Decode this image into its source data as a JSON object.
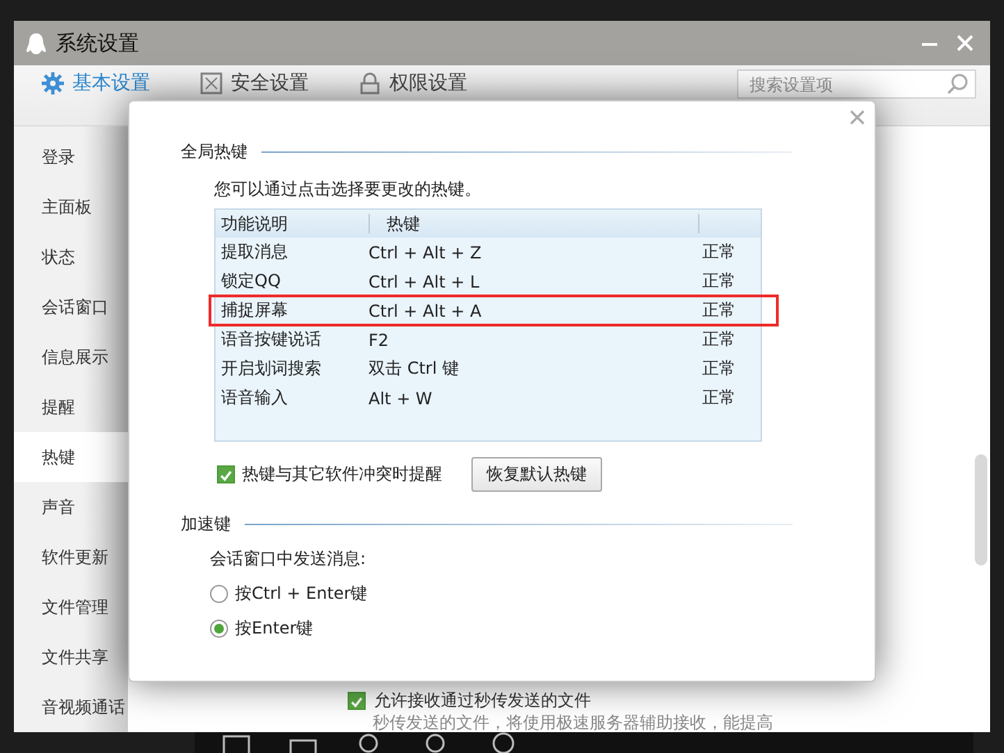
{
  "window": {
    "title": "系统设置"
  },
  "tabs": [
    {
      "label": "基本设置",
      "selected": true
    },
    {
      "label": "安全设置",
      "selected": false
    },
    {
      "label": "权限设置",
      "selected": false
    }
  ],
  "search": {
    "placeholder": "搜索设置项"
  },
  "sidebar": {
    "items": [
      {
        "label": "登录",
        "selected": false
      },
      {
        "label": "主面板",
        "selected": false
      },
      {
        "label": "状态",
        "selected": false
      },
      {
        "label": "会话窗口",
        "selected": false
      },
      {
        "label": "信息展示",
        "selected": false
      },
      {
        "label": "提醒",
        "selected": false
      },
      {
        "label": "热键",
        "selected": true
      },
      {
        "label": "声音",
        "selected": false
      },
      {
        "label": "软件更新",
        "selected": false
      },
      {
        "label": "文件管理",
        "selected": false
      },
      {
        "label": "文件共享",
        "selected": false
      },
      {
        "label": "音视频通话",
        "selected": false
      }
    ]
  },
  "background_content": {
    "checkbox": {
      "label": "允许接收通过秒传发送的文件",
      "checked": true
    },
    "description": "秒传发送的文件，将使用极速服务器辅助接收，能提高"
  },
  "dialog": {
    "global_hotkeys": {
      "heading": "全局热键",
      "hint": "您可以通过点击选择要更改的热键。",
      "table": {
        "columns": [
          "功能说明",
          "热键"
        ],
        "rows": [
          {
            "function": "提取消息",
            "hotkey": "Ctrl + Alt + Z",
            "status": "正常",
            "highlighted": false
          },
          {
            "function": "锁定QQ",
            "hotkey": "Ctrl + Alt + L",
            "status": "正常",
            "highlighted": false
          },
          {
            "function": "捕捉屏幕",
            "hotkey": "Ctrl + Alt + A",
            "status": "正常",
            "highlighted": true
          },
          {
            "function": "语音按键说话",
            "hotkey": "F2",
            "status": "正常",
            "highlighted": false
          },
          {
            "function": "开启划词搜索",
            "hotkey": "双击 Ctrl 键",
            "status": "正常",
            "highlighted": false
          },
          {
            "function": "语音输入",
            "hotkey": "Alt + W",
            "status": "正常",
            "highlighted": false
          }
        ]
      },
      "conflict_alert": {
        "label": "热键与其它软件冲突时提醒",
        "checked": true
      },
      "restore_button": "恢复默认热键"
    },
    "accelerators": {
      "heading": "加速键",
      "prompt": "会话窗口中发送消息:",
      "options": [
        {
          "label": "按Ctrl + Enter键",
          "selected": false
        },
        {
          "label": "按Enter键",
          "selected": true
        }
      ]
    }
  }
}
